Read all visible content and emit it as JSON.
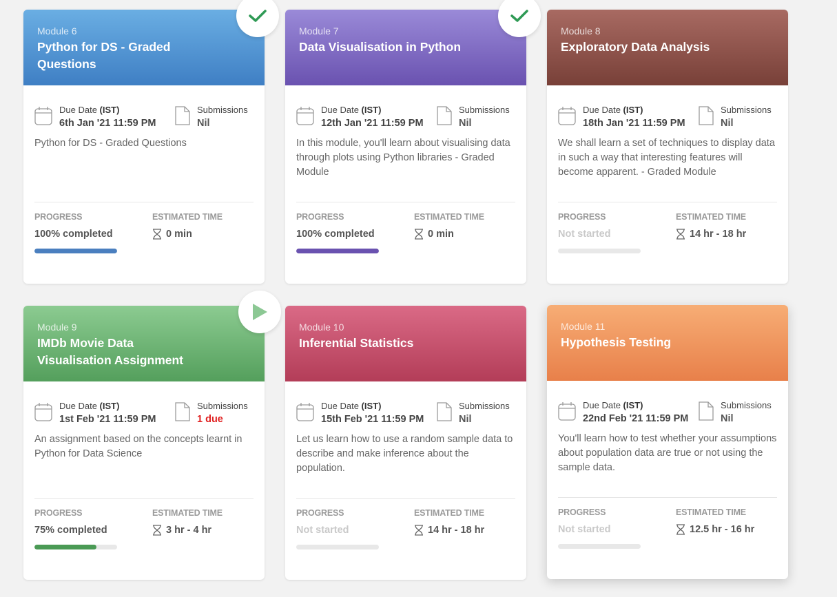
{
  "labels": {
    "due_date": "Due Date",
    "ist": "(IST)",
    "submissions": "Submissions",
    "progress": "PROGRESS",
    "estimated_time": "ESTIMATED TIME"
  },
  "cards": [
    {
      "module": "Module 6",
      "title": "Python for DS - Graded Questions",
      "due": "6th Jan '21 11:59 PM",
      "submissions": "Nil",
      "description": "Python for DS - Graded Questions",
      "progress_text": "100% completed",
      "progress_fraction": 1.0,
      "estimated": "0 min",
      "badge": "check-icon",
      "header_colors": [
        "#6aaee3",
        "#3f7fc4"
      ],
      "bar_color": "#4a7fbf"
    },
    {
      "module": "Module 7",
      "title": "Data Visualisation in Python",
      "due": "12th Jan '21 11:59 PM",
      "submissions": "Nil",
      "description": "In this module, you'll learn about visualising data through plots using Python libraries - Graded Module",
      "progress_text": "100% completed",
      "progress_fraction": 1.0,
      "estimated": "0 min",
      "badge": "check-icon",
      "header_colors": [
        "#9a8ad8",
        "#6a52b0"
      ],
      "bar_color": "#6a52b0"
    },
    {
      "module": "Module 8",
      "title": "Exploratory Data Analysis",
      "due": "18th Jan '21 11:59 PM",
      "submissions": "Nil",
      "description": "We shall learn a set of techniques to display data in such a way that interesting features will become apparent. - Graded Module",
      "progress_text": "Not started",
      "progress_fraction": 0,
      "estimated": "14 hr - 18 hr",
      "badge": "",
      "header_colors": [
        "#a86a62",
        "#784038"
      ],
      "bar_color": "#e8e8e8"
    },
    {
      "module": "Module 9",
      "title": "IMDb Movie Data Visualisation Assignment",
      "due": "1st Feb '21 11:59 PM",
      "submissions": "1 due",
      "description": "An assignment based on the concepts learnt in Python for Data Science",
      "progress_text": "75% completed",
      "progress_fraction": 0.75,
      "estimated": "3 hr - 4 hr",
      "badge": "play-icon",
      "header_colors": [
        "#8ccb91",
        "#549f5c"
      ],
      "bar_color": "#4a9a55"
    },
    {
      "module": "Module 10",
      "title": "Inferential Statistics",
      "due": "15th Feb '21 11:59 PM",
      "submissions": "Nil",
      "description": "Let us learn how to use a random sample data to describe and make inference about the population.",
      "progress_text": "Not started",
      "progress_fraction": 0,
      "estimated": "14 hr - 18 hr",
      "badge": "",
      "header_colors": [
        "#da6a86",
        "#b33d58"
      ],
      "bar_color": "#e8e8e8"
    },
    {
      "module": "Module 11",
      "title": "Hypothesis Testing",
      "due": "22nd Feb '21 11:59 PM",
      "submissions": "Nil",
      "description": "You'll learn how to test whether your assumptions about population data are true or not using the sample data.",
      "progress_text": "Not started",
      "progress_fraction": 0,
      "estimated": "12.5 hr - 16 hr",
      "badge": "",
      "header_colors": [
        "#f7ad75",
        "#e8804a"
      ],
      "bar_color": "#e8e8e8"
    }
  ]
}
